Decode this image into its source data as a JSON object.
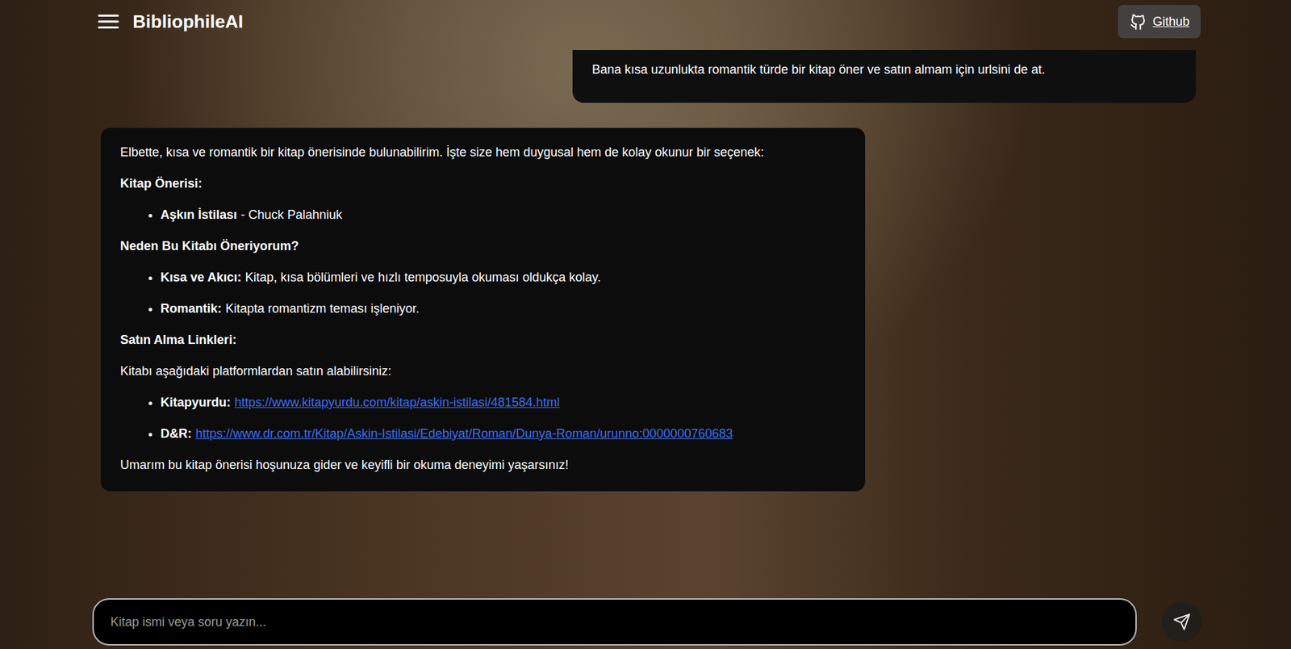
{
  "header": {
    "title": "BibliophileAI",
    "github_button": "Github"
  },
  "user_message": {
    "text": "Bana kısa uzunlukta romantik türde bir kitap öner ve satın almam için urlsini de at."
  },
  "assistant_message": {
    "intro": "Elbette, kısa ve romantik bir kitap önerisinde bulunabilirim. İşte size hem duygusal hem de kolay okunur bir seçenek:",
    "sections": [
      {
        "heading": "Kitap Önerisi:",
        "intro": "",
        "items": [
          {
            "kind": "text",
            "label": "Aşkın İstilası",
            "text": "- Chuck Palahniuk"
          }
        ]
      },
      {
        "heading": "Neden Bu Kitabı Öneriyorum?",
        "intro": "",
        "items": [
          {
            "kind": "text",
            "label": "Kısa ve Akıcı:",
            "text": "Kitap, kısa bölümleri ve hızlı temposuyla okuması oldukça kolay."
          },
          {
            "kind": "text",
            "label": "Romantik:",
            "text": "Kitapta romantizm teması işleniyor."
          }
        ]
      },
      {
        "heading": "Satın Alma Linkleri:",
        "intro": "Kitabı aşağıdaki platformlardan satın alabilirsiniz:",
        "items": [
          {
            "kind": "link",
            "label": "Kitapyurdu:",
            "text": "https://www.kitapyurdu.com/kitap/askin-istilasi/481584.html"
          },
          {
            "kind": "link",
            "label": "D&R:",
            "text": "https://www.dr.com.tr/Kitap/Askin-Istilasi/Edebiyat/Roman/Dunya-Roman/urunno:0000000760683"
          }
        ]
      }
    ],
    "outro": "Umarım bu kitap önerisi hoşunuza gider ve keyifli bir okuma deneyimi yaşarsınız!"
  },
  "input": {
    "placeholder": "Kitap ismi veya soru yazın..."
  }
}
